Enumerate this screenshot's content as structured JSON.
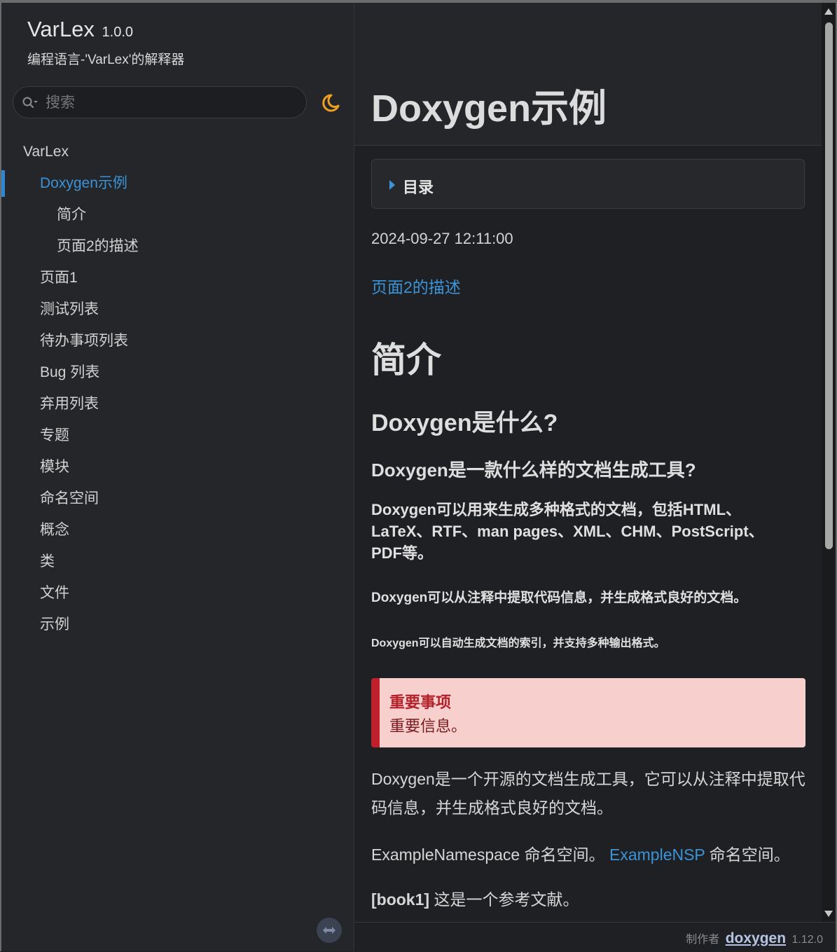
{
  "sidebar": {
    "project_name": "VarLex",
    "project_number": "1.0.0",
    "project_brief": "编程语言-'VarLex'的解释器",
    "search": {
      "placeholder": "搜索",
      "value": ""
    },
    "nav": [
      {
        "label": "VarLex",
        "level": 0,
        "active": false
      },
      {
        "label": "Doxygen示例",
        "level": 1,
        "active": true
      },
      {
        "label": "简介",
        "level": 2,
        "active": false
      },
      {
        "label": "页面2的描述",
        "level": 2,
        "active": false
      },
      {
        "label": "页面1",
        "level": 1,
        "active": false
      },
      {
        "label": "测试列表",
        "level": 1,
        "active": false
      },
      {
        "label": "待办事项列表",
        "level": 1,
        "active": false
      },
      {
        "label": "Bug 列表",
        "level": 1,
        "active": false
      },
      {
        "label": "弃用列表",
        "level": 1,
        "active": false
      },
      {
        "label": "专题",
        "level": 1,
        "active": false
      },
      {
        "label": "模块",
        "level": 1,
        "active": false
      },
      {
        "label": "命名空间",
        "level": 1,
        "active": false
      },
      {
        "label": "概念",
        "level": 1,
        "active": false
      },
      {
        "label": "类",
        "level": 1,
        "active": false
      },
      {
        "label": "文件",
        "level": 1,
        "active": false
      },
      {
        "label": "示例",
        "level": 1,
        "active": false
      }
    ]
  },
  "content": {
    "title": "Doxygen示例",
    "toc_label": "目录",
    "date": "2024-09-27 12:11:00",
    "page_link": "页面2的描述",
    "h1": "简介",
    "h2": "Doxygen是什么?",
    "h3": "Doxygen是一款什么样的文档生成工具?",
    "h4": "Doxygen可以用来生成多种格式的文档，包括HTML、LaTeX、RTF、man pages、XML、CHM、PostScript、PDF等。",
    "h5": "Doxygen可以从注释中提取代码信息，并生成格式良好的文档。",
    "h6": "Doxygen可以自动生成文档的索引，并支持多种输出格式。",
    "important_title": "重要事项",
    "important_body": "重要信息。",
    "paragraph": "Doxygen是一个开源的文档生成工具，它可以从注释中提取代码信息，并生成格式良好的文档。",
    "ns_text": "ExampleNamespace 命名空间。",
    "ns_link": "ExampleNSP",
    "ns_suffix": " 命名空间。",
    "ref_key": "[book1]",
    "ref_text": " 这是一个参考文献。"
  },
  "footer": {
    "made_by": "制作者",
    "logo": "doxygen",
    "version": "1.12.0"
  },
  "colors": {
    "accent": "#3b93d8",
    "moon": "#f0a020",
    "important_bg": "#f7d0cd",
    "important_border": "#c0202c"
  },
  "icons": {
    "search": "search-icon",
    "theme_toggle": "moon-icon",
    "resize": "resize-arrows-icon"
  }
}
